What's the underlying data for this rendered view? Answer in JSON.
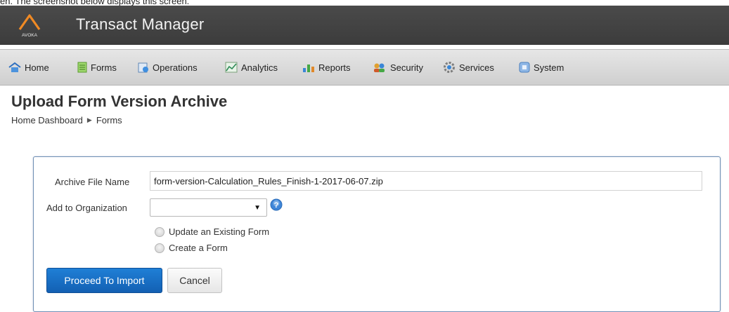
{
  "caption": "en. The screenshot below displays this screen.",
  "header": {
    "logo_text": "AVOKA",
    "app_title": "Transact Manager"
  },
  "nav": {
    "items": [
      {
        "label": "Home",
        "icon": "home-icon"
      },
      {
        "label": "Forms",
        "icon": "forms-icon"
      },
      {
        "label": "Operations",
        "icon": "operations-icon"
      },
      {
        "label": "Analytics",
        "icon": "analytics-icon"
      },
      {
        "label": "Reports",
        "icon": "reports-icon"
      },
      {
        "label": "Security",
        "icon": "security-icon"
      },
      {
        "label": "Services",
        "icon": "services-icon"
      },
      {
        "label": "System",
        "icon": "system-icon"
      }
    ]
  },
  "page": {
    "title": "Upload Form Version Archive",
    "breadcrumb": [
      "Home Dashboard",
      "Forms"
    ]
  },
  "form": {
    "archive_label": "Archive File Name",
    "archive_value": "form-version-Calculation_Rules_Finish-1-2017-06-07.zip",
    "org_label": "Add to Organization",
    "org_value": "",
    "options": [
      "Update an Existing Form",
      "Create a Form"
    ],
    "proceed_label": "Proceed To Import",
    "cancel_label": "Cancel"
  },
  "colors": {
    "header_bg": "#434343",
    "nav_bg": "#dcdcdc",
    "primary_button": "#1a6fc4",
    "panel_border": "#6f8fb5",
    "logo_accent": "#f08a24"
  }
}
